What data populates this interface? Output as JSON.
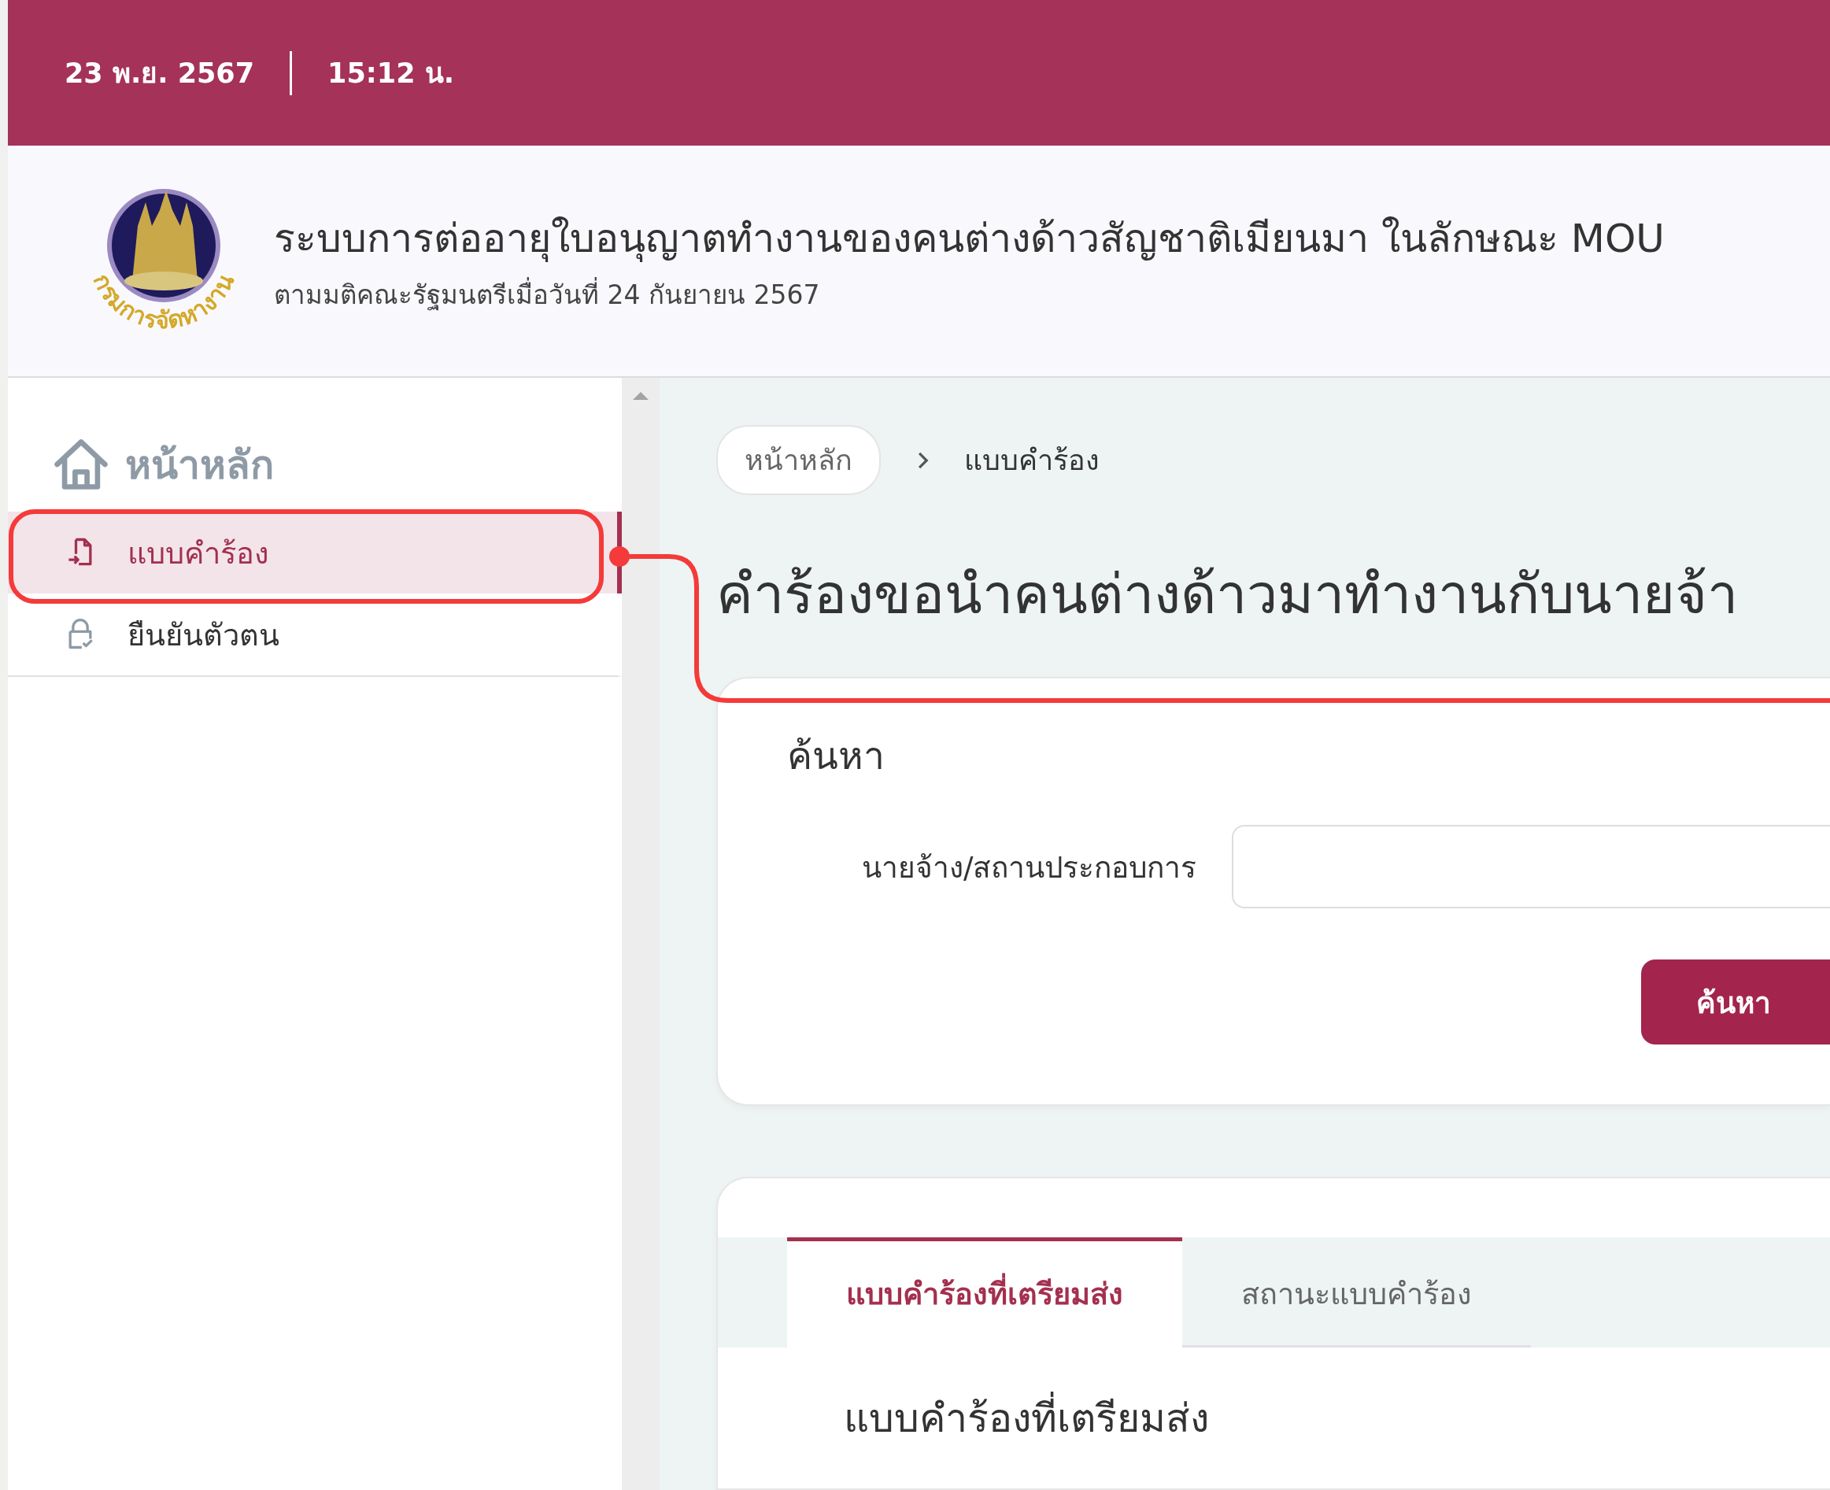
{
  "top_bar": {
    "date": "23 พ.ย. 2567",
    "time": "15:12 น."
  },
  "header": {
    "logo_text": "กรมการจัดหางาน",
    "title": "ระบบการต่ออายุใบอนุญาตทำงานของคนต่างด้าวสัญชาติเมียนมา ในลักษณะ MOU",
    "subtitle": "ตามมติคณะรัฐมนตรีเมื่อวันที่ 24 กันยายน 2567"
  },
  "sidebar": {
    "home": "หน้าหลัก",
    "items": [
      {
        "label": "แบบคำร้อง",
        "kind": "document",
        "selected": true
      },
      {
        "label": "ยืนยันตัวตน",
        "kind": "lock",
        "selected": false
      }
    ]
  },
  "breadcrumb": [
    "หน้าหลัก",
    "แบบคำร้อง"
  ],
  "page_title": "คำร้องขอนำคนต่างด้าวมาทำงานกับนายจ้า",
  "search": {
    "title": "ค้นหา",
    "field_label": "นายจ้าง/สถานประกอบการ",
    "button": "ค้นหา"
  },
  "tabs": [
    {
      "label": "แบบคำร้องที่เตรียมส่ง",
      "selected": true
    },
    {
      "label": "สถานะแบบคำร้อง",
      "selected": false
    }
  ],
  "section_title": "แบบคำร้องที่เตรียมส่ง"
}
